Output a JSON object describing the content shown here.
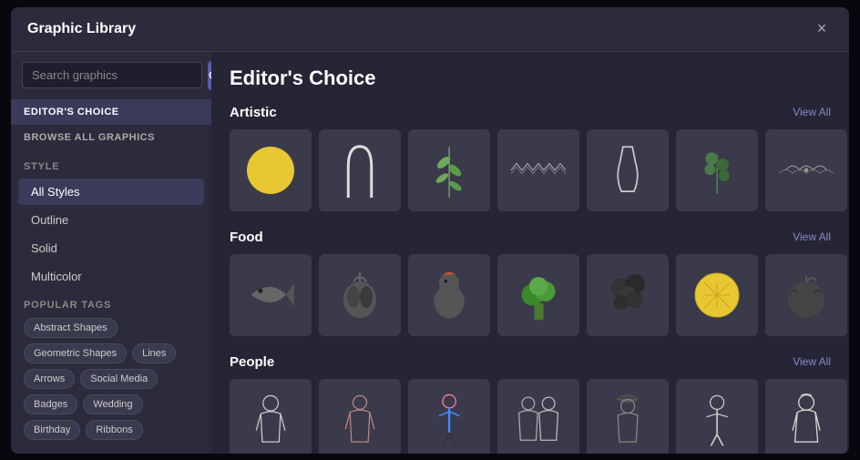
{
  "modal": {
    "title": "Graphic Library",
    "close_label": "×"
  },
  "sidebar": {
    "search_placeholder": "Search graphics",
    "search_icon": "🔍",
    "nav_items": [
      {
        "id": "editors_choice",
        "label": "EDITOR'S CHOICE",
        "active": true
      },
      {
        "id": "browse_all",
        "label": "BROWSE ALL GRAPHICS",
        "active": false
      }
    ],
    "style_section_label": "STYLE",
    "styles": [
      {
        "id": "all_styles",
        "label": "All Styles",
        "active": true
      },
      {
        "id": "outline",
        "label": "Outline",
        "active": false
      },
      {
        "id": "solid",
        "label": "Solid",
        "active": false
      },
      {
        "id": "multicolor",
        "label": "Multicolor",
        "active": false
      }
    ],
    "popular_tags_label": "POPULAR TAGS",
    "tags": [
      "Abstract Shapes",
      "Geometric Shapes",
      "Lines",
      "Arrows",
      "Social Media",
      "Badges",
      "Wedding",
      "Birthday",
      "Ribbons"
    ]
  },
  "main": {
    "page_title": "Editor's Choice",
    "categories": [
      {
        "id": "artistic",
        "title": "Artistic",
        "view_all": "View All",
        "items": [
          {
            "id": "art1",
            "type": "circle_yellow",
            "desc": "Yellow circle"
          },
          {
            "id": "art2",
            "type": "arch_white",
            "desc": "White arch"
          },
          {
            "id": "art3",
            "type": "leaves_green",
            "desc": "Green leaves branch"
          },
          {
            "id": "art4",
            "type": "waves_dark",
            "desc": "Dark waves pattern"
          },
          {
            "id": "art5",
            "type": "vase_white",
            "desc": "White vase"
          },
          {
            "id": "art6",
            "type": "plant_green",
            "desc": "Green plant"
          },
          {
            "id": "art7",
            "type": "bird_dark",
            "desc": "Dark bird decoration"
          }
        ]
      },
      {
        "id": "food",
        "title": "Food",
        "view_all": "View All",
        "items": [
          {
            "id": "food1",
            "type": "fish_dark",
            "desc": "Dark fish"
          },
          {
            "id": "food2",
            "type": "garlic_dark",
            "desc": "Dark garlic"
          },
          {
            "id": "food3",
            "type": "chicken_dark",
            "desc": "Dark chicken"
          },
          {
            "id": "food4",
            "type": "broccoli_green",
            "desc": "Green broccoli"
          },
          {
            "id": "food5",
            "type": "herbs_dark",
            "desc": "Dark herbs"
          },
          {
            "id": "food6",
            "type": "lemon_yellow",
            "desc": "Yellow lemon"
          },
          {
            "id": "food7",
            "type": "fruit_dark",
            "desc": "Dark fruit"
          }
        ]
      },
      {
        "id": "people",
        "title": "People",
        "view_all": "View All",
        "items": [
          {
            "id": "ppl1",
            "type": "person1",
            "desc": "Person illustration 1"
          },
          {
            "id": "ppl2",
            "type": "person2",
            "desc": "Person illustration 2"
          },
          {
            "id": "ppl3",
            "type": "person3",
            "desc": "Person illustration 3"
          },
          {
            "id": "ppl4",
            "type": "person4",
            "desc": "Person illustration 4"
          },
          {
            "id": "ppl5",
            "type": "person5",
            "desc": "Person illustration 5"
          },
          {
            "id": "ppl6",
            "type": "person6",
            "desc": "Person illustration 6"
          },
          {
            "id": "ppl7",
            "type": "person7",
            "desc": "Person illustration 7"
          }
        ]
      }
    ]
  }
}
